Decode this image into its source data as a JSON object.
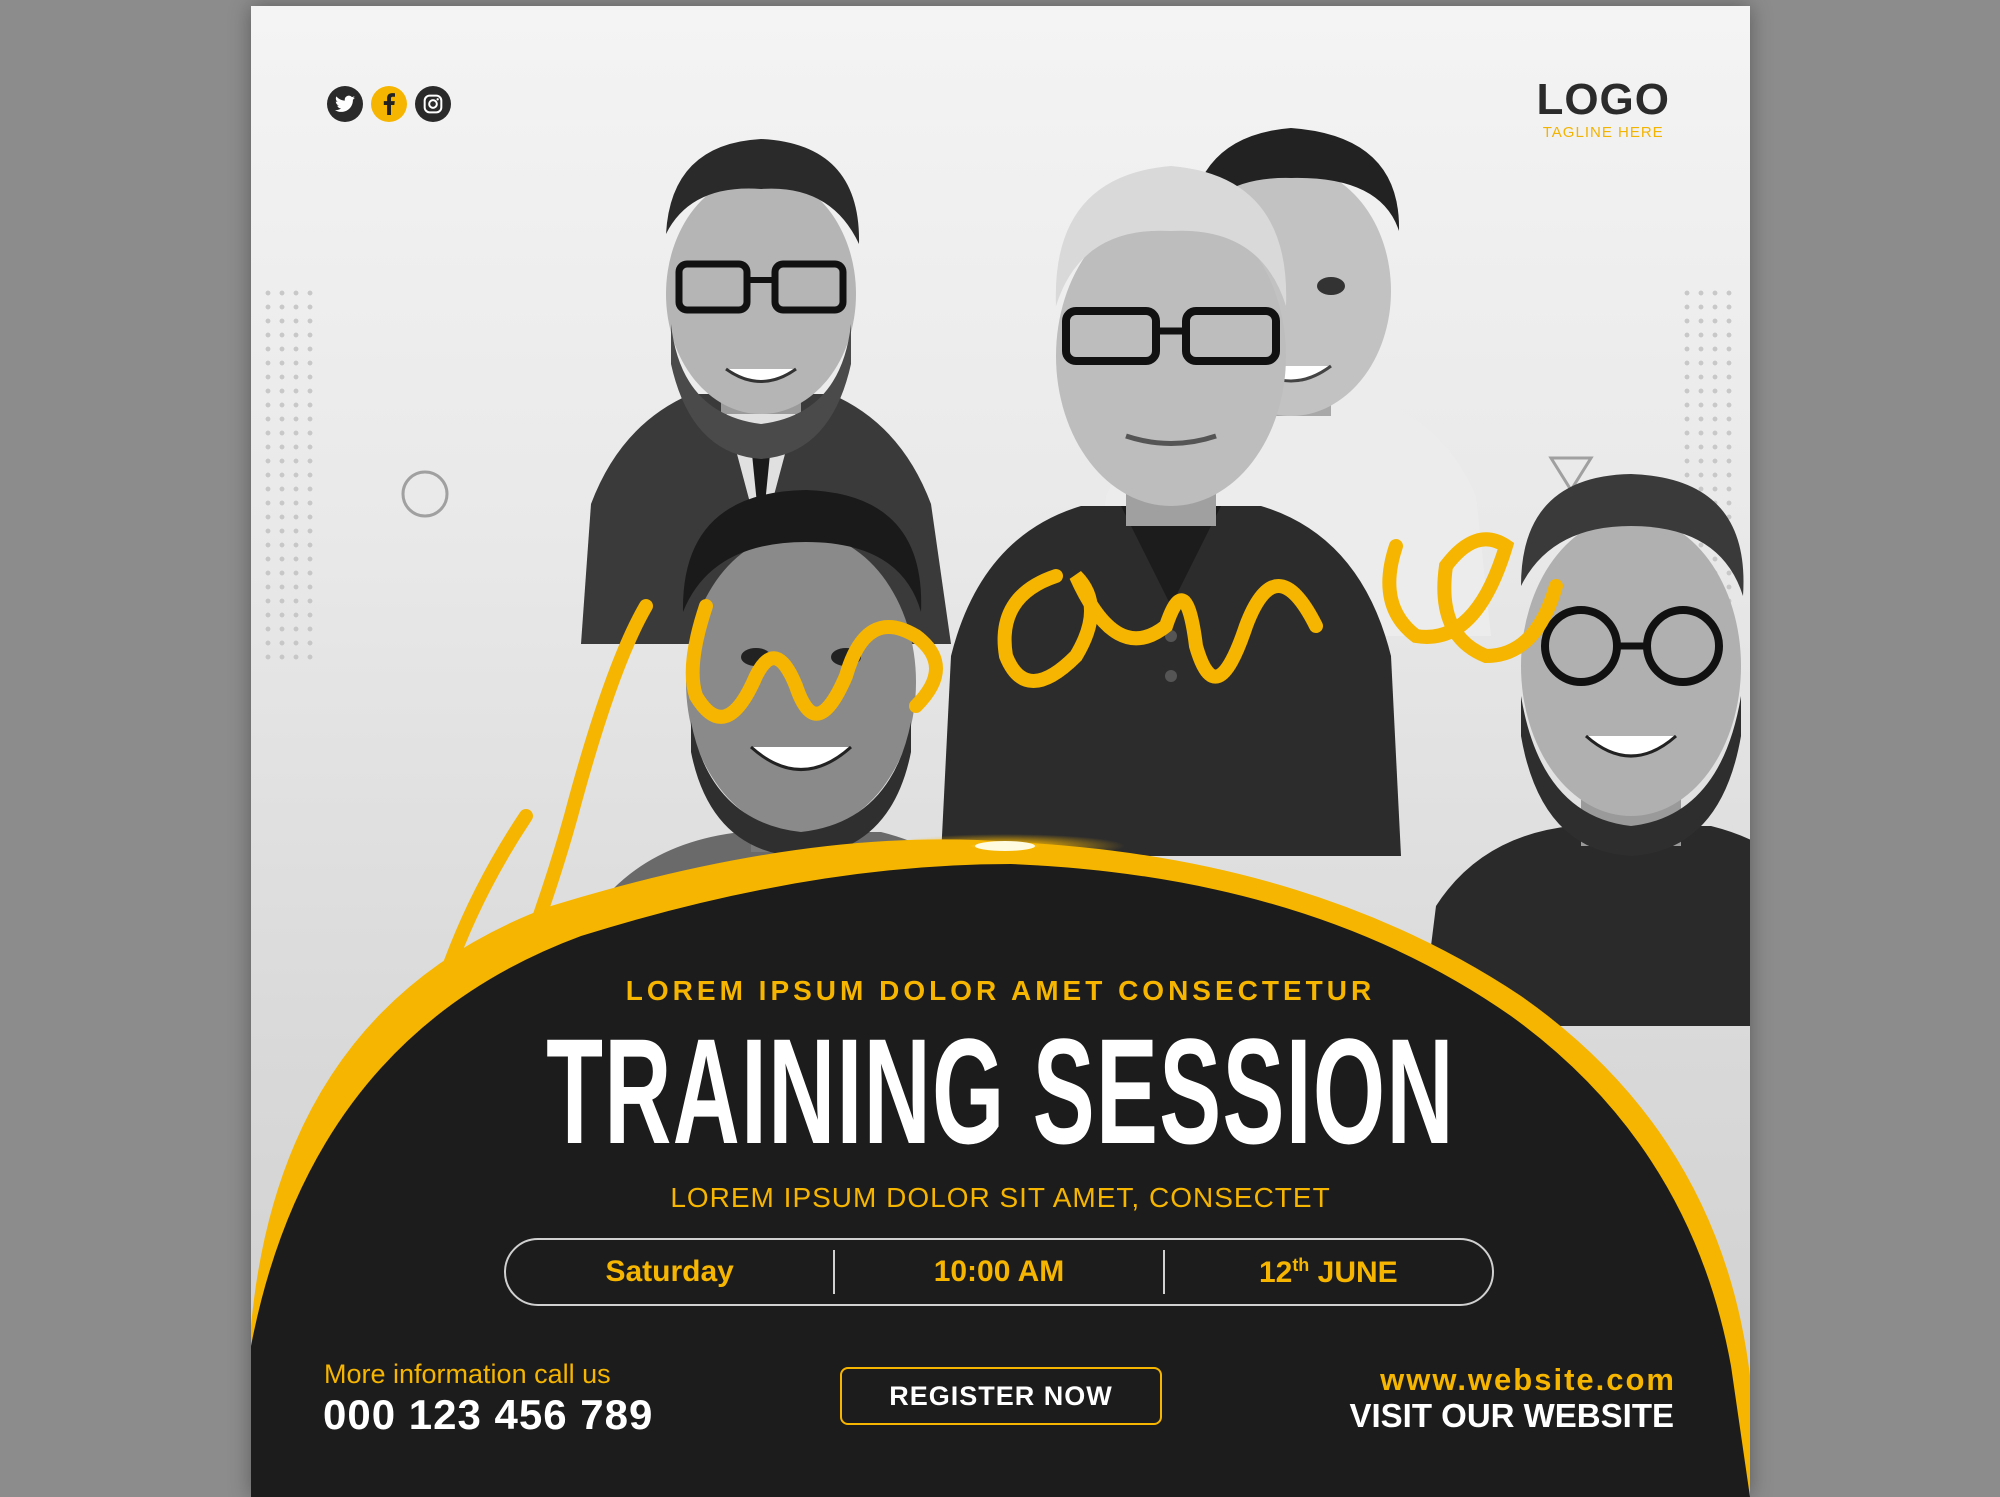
{
  "social": {
    "icons": [
      "twitter-icon",
      "facebook-icon",
      "instagram-icon"
    ]
  },
  "logo": {
    "main": "LOGO",
    "tagline": "TAGLINE HERE"
  },
  "script_text": "join online",
  "subtitle": "LOREM IPSUM DOLOR AMET CONSECTETUR",
  "title": "TRAINING SESSION",
  "tagline": "LOREM IPSUM DOLOR SIT AMET, CONSECTET",
  "schedule": {
    "day": "Saturday",
    "time": "10:00 AM",
    "date_day": "12",
    "date_suffix": "th",
    "date_month": "JUNE"
  },
  "contact": {
    "label": "More information call us",
    "phone": "000 123 456 789"
  },
  "register_label": "REGISTER NOW",
  "website": {
    "url": "www.website.com",
    "cta": "VISIT OUR WEBSITE"
  },
  "colors": {
    "accent": "#f6b500",
    "dark": "#1c1c1c",
    "background": "#8c8c8c"
  }
}
